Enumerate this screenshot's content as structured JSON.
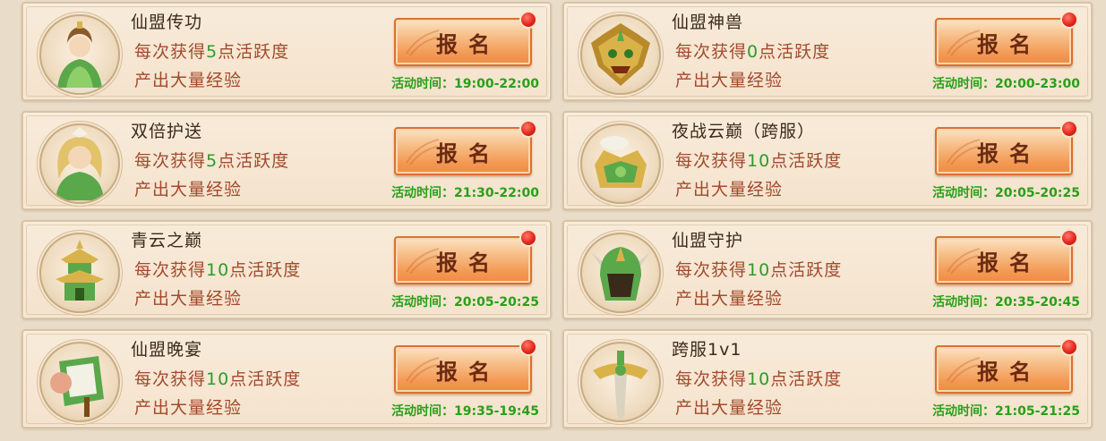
{
  "cards": [
    {
      "title": "仙盟传功",
      "gain_prefix": "每次获得",
      "gain_num": "5",
      "gain_suffix": "点活跃度",
      "desc": "产出大量经验",
      "time": "活动时间：19:00-22:00",
      "button": "报名",
      "icon": "immortal-sage-icon"
    },
    {
      "title": "仙盟神兽",
      "gain_prefix": "每次获得",
      "gain_num": "0",
      "gain_suffix": "点活跃度",
      "desc": "产出大量经验",
      "time": "活动时间：20:00-23:00",
      "button": "报名",
      "icon": "beast-mask-icon"
    },
    {
      "title": "双倍护送",
      "gain_prefix": "每次获得",
      "gain_num": "5",
      "gain_suffix": "点活跃度",
      "desc": "产出大量经验",
      "time": "活动时间：21:30-22:00",
      "button": "报名",
      "icon": "escort-maiden-icon"
    },
    {
      "title": "夜战云巅（跨服）",
      "gain_prefix": "每次获得",
      "gain_num": "10",
      "gain_suffix": "点活跃度",
      "desc": "产出大量经验",
      "time": "活动时间：20:05-20:25",
      "button": "报名",
      "icon": "cloud-peak-crown-icon"
    },
    {
      "title": "青云之巅",
      "gain_prefix": "每次获得",
      "gain_num": "10",
      "gain_suffix": "点活跃度",
      "desc": "产出大量经验",
      "time": "活动时间：20:05-20:25",
      "button": "报名",
      "icon": "pagoda-icon"
    },
    {
      "title": "仙盟守护",
      "gain_prefix": "每次获得",
      "gain_num": "10",
      "gain_suffix": "点活跃度",
      "desc": "产出大量经验",
      "time": "活动时间：20:35-20:45",
      "button": "报名",
      "icon": "guardian-helmet-icon"
    },
    {
      "title": "仙盟晚宴",
      "gain_prefix": "每次获得",
      "gain_num": "10",
      "gain_suffix": "点活跃度",
      "desc": "产出大量经验",
      "time": "活动时间：19:35-19:45",
      "button": "报名",
      "icon": "banquet-scroll-icon"
    },
    {
      "title": "跨服1v1",
      "gain_prefix": "每次获得",
      "gain_num": "10",
      "gain_suffix": "点活跃度",
      "desc": "产出大量经验",
      "time": "活动时间：21:05-21:25",
      "button": "报名",
      "icon": "crossed-sword-icon"
    }
  ],
  "colors": {
    "accent_green": "#2f9a2a",
    "text_red": "#a24a2c",
    "button_orange": "#f39a55",
    "badge_red": "#e4271c"
  }
}
